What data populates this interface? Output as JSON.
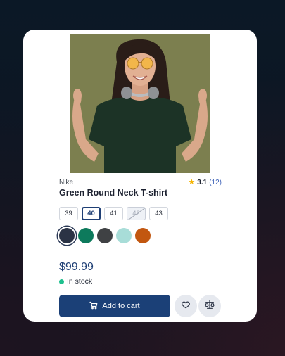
{
  "product": {
    "brand": "Nike",
    "rating": "3.1",
    "review_count": "(12)",
    "title": "Green Round Neck T-shirt",
    "price": "$99.99",
    "stock_status": "In stock",
    "image_icon": "product-photo-person-green-tshirt",
    "image_background_color": "#7c7f4f"
  },
  "sizes": [
    {
      "label": "39",
      "state": "default"
    },
    {
      "label": "40",
      "state": "selected"
    },
    {
      "label": "41",
      "state": "default"
    },
    {
      "label": "42",
      "state": "unavailable"
    },
    {
      "label": "43",
      "state": "default"
    }
  ],
  "colors": [
    {
      "hex": "#2b3345",
      "selected": true
    },
    {
      "hex": "#0d7a5c",
      "selected": false
    },
    {
      "hex": "#3f4144",
      "selected": false
    },
    {
      "hex": "#a8ddd8",
      "selected": false
    },
    {
      "hex": "#c25710",
      "selected": false
    }
  ],
  "actions": {
    "add_to_cart_label": "Add to cart",
    "add_to_cart_icon": "cart-icon",
    "wishlist_icon": "heart-icon",
    "compare_icon": "scale-icon"
  },
  "theme": {
    "accent": "#1b4077",
    "star_color": "#f5b400",
    "in_stock_color": "#1ec08e"
  }
}
